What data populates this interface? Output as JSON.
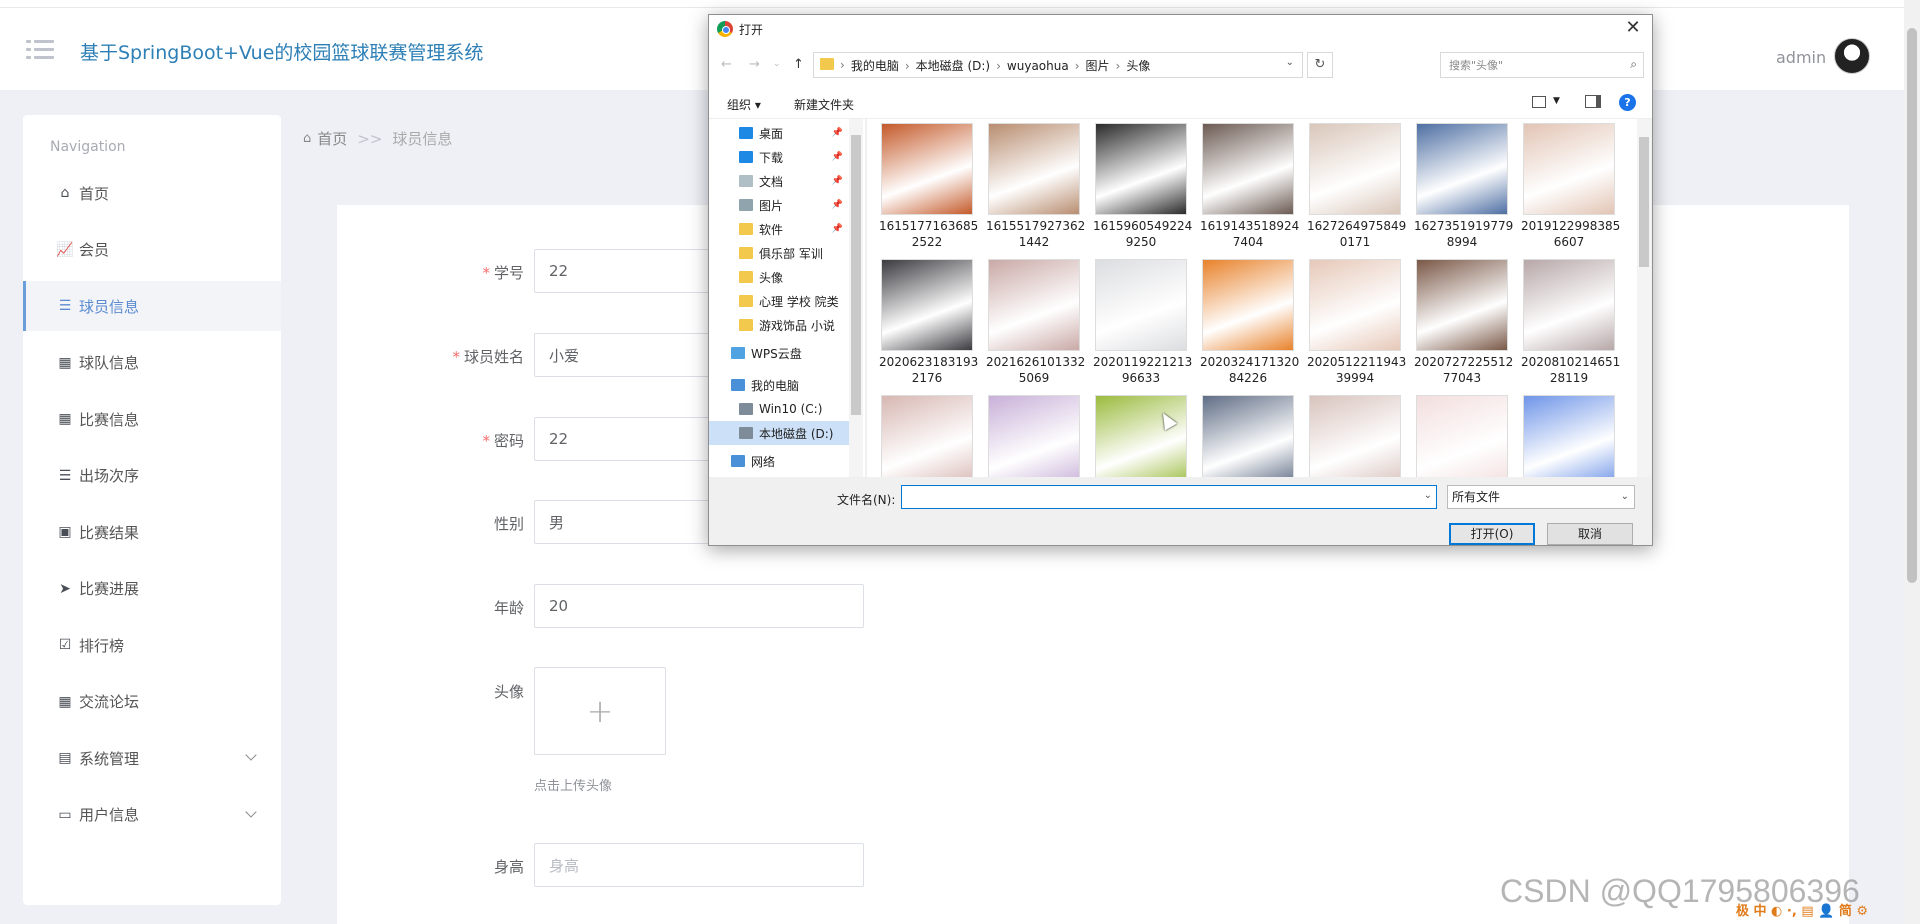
{
  "header": {
    "app_title": "基于SpringBoot+Vue的校园篮球联赛管理系统",
    "user_name": "admin"
  },
  "sidebar": {
    "title": "Navigation",
    "items": [
      {
        "label": "首页",
        "icon": "home-icon"
      },
      {
        "label": "会员",
        "icon": "chart-icon"
      },
      {
        "label": "球员信息",
        "icon": "list-icon",
        "active": true
      },
      {
        "label": "球队信息",
        "icon": "grid-icon"
      },
      {
        "label": "比赛信息",
        "icon": "grid-icon"
      },
      {
        "label": "出场次序",
        "icon": "list-icon"
      },
      {
        "label": "比赛结果",
        "icon": "clipboard-icon"
      },
      {
        "label": "比赛进展",
        "icon": "send-icon"
      },
      {
        "label": "排行榜",
        "icon": "check-icon"
      },
      {
        "label": "交流论坛",
        "icon": "grid-icon"
      },
      {
        "label": "系统管理",
        "icon": "message-icon",
        "expandable": true
      },
      {
        "label": "用户信息",
        "icon": "card-icon",
        "expandable": true
      }
    ]
  },
  "breadcrumb": {
    "home": "首页",
    "separator": ">>",
    "current": "球员信息"
  },
  "form": {
    "student_id": {
      "label": "学号",
      "value": "22",
      "required": true
    },
    "player_name": {
      "label": "球员姓名",
      "value": "小爱",
      "required": true
    },
    "password": {
      "label": "密码",
      "value": "22",
      "required": true
    },
    "gender": {
      "label": "性别",
      "value": "男"
    },
    "age": {
      "label": "年龄",
      "value": "20"
    },
    "avatar": {
      "label": "头像",
      "hint": "点击上传头像"
    },
    "height": {
      "label": "身高",
      "placeholder": "身高"
    }
  },
  "dialog": {
    "title": "打开",
    "path": [
      "我的电脑",
      "本地磁盘 (D:)",
      "wuyaohua",
      "图片",
      "头像"
    ],
    "search_placeholder": "搜索\"头像\"",
    "toolbar": {
      "organize": "组织 ▾",
      "new_folder": "新建文件夹"
    },
    "tree": [
      {
        "label": "桌面",
        "color": "#1e88e5",
        "pinned": true
      },
      {
        "label": "下载",
        "color": "#1e88e5",
        "pinned": true
      },
      {
        "label": "文档",
        "color": "#b0bec5",
        "pinned": true
      },
      {
        "label": "图片",
        "color": "#90a4ae",
        "pinned": true
      },
      {
        "label": "软件",
        "color": "#f2c94c",
        "pinned": true
      },
      {
        "label": "俱乐部 军训",
        "color": "#f2c94c"
      },
      {
        "label": "头像",
        "color": "#f2c94c"
      },
      {
        "label": "心理 学校 院类",
        "color": "#f2c94c"
      },
      {
        "label": "游戏饰品 小说",
        "color": "#f2c94c"
      },
      {
        "label": "WPS云盘",
        "color": "#4fa3e0"
      },
      {
        "label": "我的电脑",
        "color": "#4a90d9"
      },
      {
        "label": "Win10 (C:)",
        "color": "#7e8c99"
      },
      {
        "label": "本地磁盘 (D:)",
        "color": "#7e8c99",
        "selected": true
      },
      {
        "label": "网络",
        "color": "#4a90d9"
      }
    ],
    "files": [
      {
        "name": "1615177163685\n2522",
        "color": "#c45a2a"
      },
      {
        "name": "1615517927362\n1442",
        "color": "#b88d70"
      },
      {
        "name": "1615960549224\n9250",
        "color": "#2a2a2a"
      },
      {
        "name": "1619143518924\n7404",
        "color": "#6b5a52"
      },
      {
        "name": "1627264975849\n0171",
        "color": "#d9c6b9"
      },
      {
        "name": "1627351919779\n8994",
        "color": "#4e6fa3"
      },
      {
        "name": "2019122998385\n6607",
        "color": "#e2c4b4"
      },
      {
        "name": "2020623183193\n2176",
        "color": "#3b3b40"
      },
      {
        "name": "2021626101332\n5069",
        "color": "#c9a9a6"
      },
      {
        "name": "2020119221213\n96633",
        "color": "#dcdde0"
      },
      {
        "name": "2020324171320\n84226",
        "color": "#e8822b"
      },
      {
        "name": "2020512211943\n39994",
        "color": "#e6c8b8"
      },
      {
        "name": "2020727225512\n77043",
        "color": "#7a5847"
      },
      {
        "name": "2020810214651\n28119",
        "color": "#b7a7a8"
      },
      {
        "name": "",
        "color": "#d7b7b2"
      },
      {
        "name": "",
        "color": "#c8b0d8"
      },
      {
        "name": "",
        "color": "#9bbb3e"
      },
      {
        "name": "",
        "color": "#5f6d85"
      },
      {
        "name": "",
        "color": "#d8c3bd"
      },
      {
        "name": "",
        "color": "#f3dede"
      },
      {
        "name": "",
        "color": "#6f95e8"
      }
    ],
    "filename_label": "文件名(N):",
    "filename_value": "",
    "filetype": "所有文件",
    "open_label": "打开(O)",
    "cancel_label": "取消"
  },
  "watermark": "CSDN @QQ1795806396",
  "ime_bar": "极 中 ◐ ·, ▤ 👤 简 ⚙"
}
